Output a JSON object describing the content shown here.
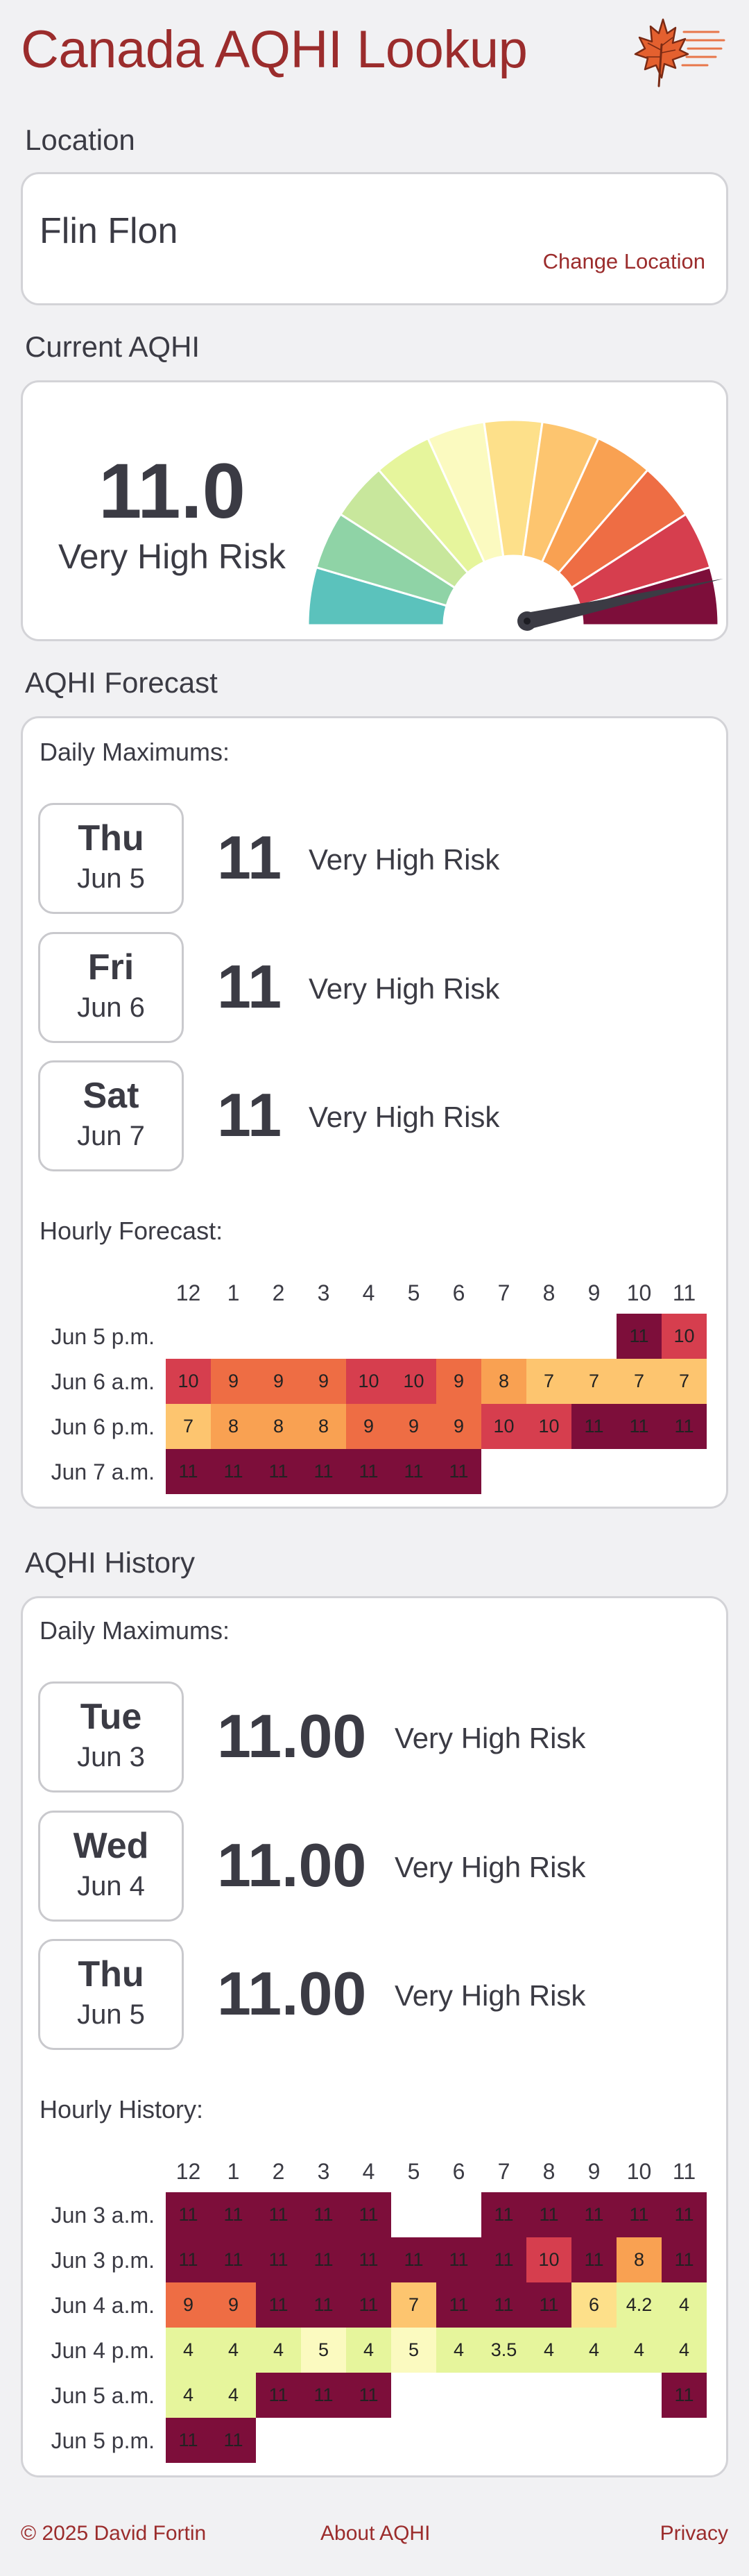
{
  "app": {
    "title": "Canada AQHI Lookup"
  },
  "location": {
    "heading": "Location",
    "value": "Flin Flon",
    "change_link": "Change Location"
  },
  "current": {
    "heading": "Current AQHI",
    "value": "11.0",
    "risk": "Very High Risk",
    "gauge_level": 11
  },
  "colors": {
    "1": "#5bc2bc",
    "2": "#8fd3a6",
    "3": "#c8e79c",
    "4": "#e6f59c",
    "5": "#fbfac0",
    "6": "#fde08a",
    "7": "#fdc56f",
    "8": "#f9a152",
    "9": "#ee6d44",
    "10": "#d63e4e",
    "11": "#7d0e3a"
  },
  "forecast": {
    "heading": "AQHI Forecast",
    "daily_label": "Daily Maximums:",
    "daily": [
      {
        "day": "Thu",
        "date": "Jun 5",
        "value": "11",
        "risk": "Very High Risk"
      },
      {
        "day": "Fri",
        "date": "Jun 6",
        "value": "11",
        "risk": "Very High Risk"
      },
      {
        "day": "Sat",
        "date": "Jun 7",
        "value": "11",
        "risk": "Very High Risk"
      }
    ],
    "hourly_label": "Hourly Forecast:",
    "hours": [
      "12",
      "1",
      "2",
      "3",
      "4",
      "5",
      "6",
      "7",
      "8",
      "9",
      "10",
      "11"
    ],
    "rows": [
      {
        "label": "Jun 5 p.m.",
        "cells": [
          null,
          null,
          null,
          null,
          null,
          null,
          null,
          null,
          null,
          null,
          "11",
          "10"
        ]
      },
      {
        "label": "Jun 6 a.m.",
        "cells": [
          "10",
          "9",
          "9",
          "9",
          "10",
          "10",
          "9",
          "8",
          "7",
          "7",
          "7",
          "7"
        ]
      },
      {
        "label": "Jun 6 p.m.",
        "cells": [
          "7",
          "8",
          "8",
          "8",
          "9",
          "9",
          "9",
          "10",
          "10",
          "11",
          "11",
          "11"
        ]
      },
      {
        "label": "Jun 7 a.m.",
        "cells": [
          "11",
          "11",
          "11",
          "11",
          "11",
          "11",
          "11",
          null,
          null,
          null,
          null,
          null
        ]
      }
    ]
  },
  "history": {
    "heading": "AQHI History",
    "daily_label": "Daily Maximums:",
    "daily": [
      {
        "day": "Tue",
        "date": "Jun 3",
        "value": "11.00",
        "risk": "Very High Risk"
      },
      {
        "day": "Wed",
        "date": "Jun 4",
        "value": "11.00",
        "risk": "Very High Risk"
      },
      {
        "day": "Thu",
        "date": "Jun 5",
        "value": "11.00",
        "risk": "Very High Risk"
      }
    ],
    "hourly_label": "Hourly History:",
    "hours": [
      "12",
      "1",
      "2",
      "3",
      "4",
      "5",
      "6",
      "7",
      "8",
      "9",
      "10",
      "11"
    ],
    "rows": [
      {
        "label": "Jun 3 a.m.",
        "cells": [
          "11",
          "11",
          "11",
          "11",
          "11",
          null,
          null,
          "11",
          "11",
          "11",
          "11",
          "11"
        ]
      },
      {
        "label": "Jun 3 p.m.",
        "cells": [
          "11",
          "11",
          "11",
          "11",
          "11",
          "11",
          "11",
          "11",
          "10",
          "11",
          "8",
          "11"
        ]
      },
      {
        "label": "Jun 4 a.m.",
        "cells": [
          "9",
          "9",
          "11",
          "11",
          "11",
          "7",
          "11",
          "11",
          "11",
          "6",
          "4.2",
          "4"
        ]
      },
      {
        "label": "Jun 4 p.m.",
        "cells": [
          "4",
          "4",
          "4",
          "5",
          "4",
          "5",
          "4",
          "3.5",
          "4",
          "4",
          "4",
          "4"
        ]
      },
      {
        "label": "Jun 5 a.m.",
        "cells": [
          "4",
          "4",
          "11",
          "11",
          "11",
          null,
          null,
          null,
          null,
          null,
          null,
          "11"
        ]
      },
      {
        "label": "Jun 5 p.m.",
        "cells": [
          "11",
          "11",
          null,
          null,
          null,
          null,
          null,
          null,
          null,
          null,
          null,
          null
        ]
      }
    ]
  },
  "footer": {
    "copyright": "© 2025 David Fortin",
    "about": "About AQHI",
    "privacy": "Privacy"
  }
}
